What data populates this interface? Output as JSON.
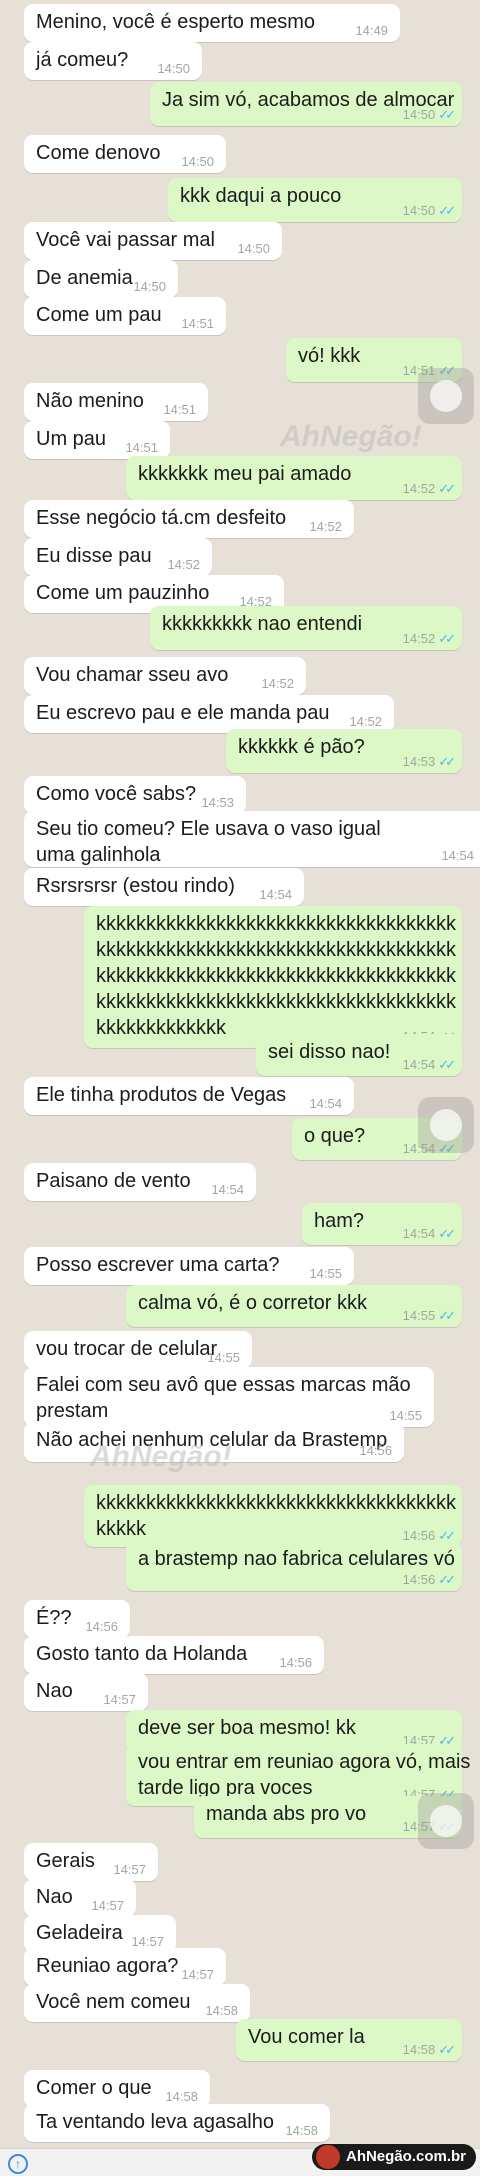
{
  "messages": [
    {
      "side": "in",
      "text": "Menino, você é esperto mesmo",
      "time": "14:49"
    },
    {
      "side": "in",
      "text": "já comeu?",
      "time": "14:50"
    },
    {
      "side": "out",
      "text": "Ja sim vó, acabamos de almocar",
      "time": "14:50"
    },
    {
      "side": "in",
      "text": "Come denovo",
      "time": "14:50"
    },
    {
      "side": "out",
      "text": "kkk daqui a pouco",
      "time": "14:50"
    },
    {
      "side": "in",
      "text": "Você vai passar mal",
      "time": "14:50"
    },
    {
      "side": "in",
      "text": "De anemia",
      "time": "14:50"
    },
    {
      "side": "in",
      "text": "Come um pau",
      "time": "14:51"
    },
    {
      "side": "out",
      "text": "vó! kkk",
      "time": "14:51"
    },
    {
      "side": "in",
      "text": "Não menino",
      "time": "14:51"
    },
    {
      "side": "in",
      "text": "Um pau",
      "time": "14:51"
    },
    {
      "side": "out",
      "text": "kkkkkkk meu pai amado",
      "time": "14:52"
    },
    {
      "side": "in",
      "text": "Esse negócio tá.cm desfeito",
      "time": "14:52"
    },
    {
      "side": "in",
      "text": "Eu disse pau",
      "time": "14:52"
    },
    {
      "side": "in",
      "text": "Come um pauzinho",
      "time": "14:52"
    },
    {
      "side": "out",
      "text": "kkkkkkkkk nao entendi",
      "time": "14:52"
    },
    {
      "side": "in",
      "text": "Vou chamar sseu avo",
      "time": "14:52"
    },
    {
      "side": "in",
      "text": "Eu escrevo pau e ele manda pau",
      "time": "14:52"
    },
    {
      "side": "out",
      "text": "kkkkkk é pão?",
      "time": "14:53"
    },
    {
      "side": "in",
      "text": "Como você sabs?",
      "time": "14:53"
    },
    {
      "side": "in",
      "text": "Seu tio comeu? Ele usava o vaso igual\numa galinhola",
      "time": "14:54"
    },
    {
      "side": "in",
      "text": "Rsrsrsrsr (estou rindo)",
      "time": "14:54"
    },
    {
      "side": "out",
      "text": "kkkkkkkkkkkkkkkkkkkkkkkkkkkkkkkkkkkk\nkkkkkkkkkkkkkkkkkkkkkkkkkkkkkkkkkkkk\nkkkkkkkkkkkkkkkkkkkkkkkkkkkkkkkkkkkk\nkkkkkkkkkkkkkkkkkkkkkkkkkkkkkkkkkkkk\nkkkkkkkkkkkkk",
      "time": "14:54"
    },
    {
      "side": "out",
      "text": "sei disso nao!",
      "time": "14:54"
    },
    {
      "side": "in",
      "text": "Ele tinha produtos de Vegas",
      "time": "14:54"
    },
    {
      "side": "out",
      "text": "o que?",
      "time": "14:54"
    },
    {
      "side": "in",
      "text": "Paisano de vento",
      "time": "14:54"
    },
    {
      "side": "out",
      "text": "ham?",
      "time": "14:54"
    },
    {
      "side": "in",
      "text": "Posso escrever uma carta?",
      "time": "14:55"
    },
    {
      "side": "out",
      "text": "calma vó, é o corretor kkk",
      "time": "14:55"
    },
    {
      "side": "in",
      "text": "vou trocar de celular",
      "time": "14:55"
    },
    {
      "side": "in",
      "text": "Falei com seu avô que essas marcas mão\nprestam",
      "time": "14:55"
    },
    {
      "side": "in",
      "text": "Não achei nenhum celular da Brastemp",
      "time": "14:56"
    },
    {
      "side": "out",
      "text": "kkkkkkkkkkkkkkkkkkkkkkkkkkkkkkkkkkkk\nkkkkk",
      "time": "14:56"
    },
    {
      "side": "out",
      "text": "a brastemp nao fabrica celulares vó",
      "time": "14:56"
    },
    {
      "side": "in",
      "text": "É??",
      "time": "14:56"
    },
    {
      "side": "in",
      "text": "Gosto tanto da Holanda",
      "time": "14:56"
    },
    {
      "side": "in",
      "text": "Nao",
      "time": "14:57"
    },
    {
      "side": "out",
      "text": "deve ser boa mesmo! kk",
      "time": "14:57"
    },
    {
      "side": "out",
      "text": "vou entrar em reuniao agora vó, mais\ntarde ligo pra voces",
      "time": "14:57"
    },
    {
      "side": "out",
      "text": "manda abs pro vo",
      "time": "14:57"
    },
    {
      "side": "in",
      "text": "Gerais",
      "time": "14:57"
    },
    {
      "side": "in",
      "text": "Nao",
      "time": "14:57"
    },
    {
      "side": "in",
      "text": "Geladeira",
      "time": "14:57"
    },
    {
      "side": "in",
      "text": "Reuniao agora?",
      "time": "14:57"
    },
    {
      "side": "in",
      "text": "Você nem comeu",
      "time": "14:58"
    },
    {
      "side": "out",
      "text": "Vou comer la",
      "time": "14:58"
    },
    {
      "side": "in",
      "text": "Comer o que",
      "time": "14:58"
    },
    {
      "side": "in",
      "text": "Ta ventando leva agasalho",
      "time": "14:58"
    }
  ],
  "watermark": {
    "text": "AhNegão!",
    "site": "AhNegão.com.br"
  },
  "colors": {
    "incoming": "#ffffff",
    "outgoing": "#dcf8c6",
    "background": "#e7e0d6",
    "read_ticks": "#4fb6ec"
  },
  "icons": {
    "read_receipt": "double-check-icon",
    "send": "arrow-up-icon"
  }
}
